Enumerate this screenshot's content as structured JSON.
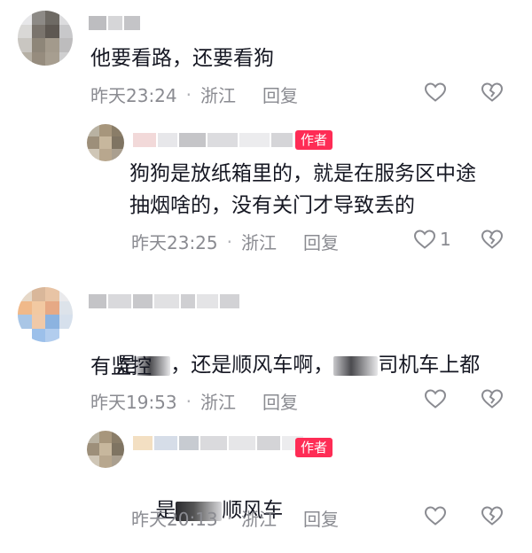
{
  "comments": [
    {
      "text": "他要看路，还要看狗",
      "time": "昨天23:24",
      "sep": "·",
      "location": "浙江",
      "reply_label": "回复",
      "like_count": ""
    },
    {
      "badge": "作者",
      "text_line1": "狗狗是放纸箱里的，就是在服务区中途",
      "text_line2": "抽烟啥的，没有关门才导致丢的",
      "time": "昨天23:25",
      "sep": "·",
      "location": "浙江",
      "reply_label": "回复",
      "like_count": "1"
    },
    {
      "text_a": "是",
      "text_b": "，还是顺风车啊，",
      "text_c": "司机车上都",
      "text_line2": "有监控",
      "time": "昨天19:53",
      "sep": "·",
      "location": "浙江",
      "reply_label": "回复",
      "like_count": ""
    },
    {
      "badge": "作者",
      "text_a": "是",
      "text_b": "顺风车",
      "time": "昨天20:13",
      "sep": "·",
      "location": "浙江",
      "reply_label": "回复"
    }
  ],
  "icons": {
    "like": "heart-outline-icon",
    "dislike": "broken-heart-icon"
  },
  "colors": {
    "badge": "#fe2c55",
    "meta_text": "#8a8b91",
    "body_text": "#161823"
  }
}
